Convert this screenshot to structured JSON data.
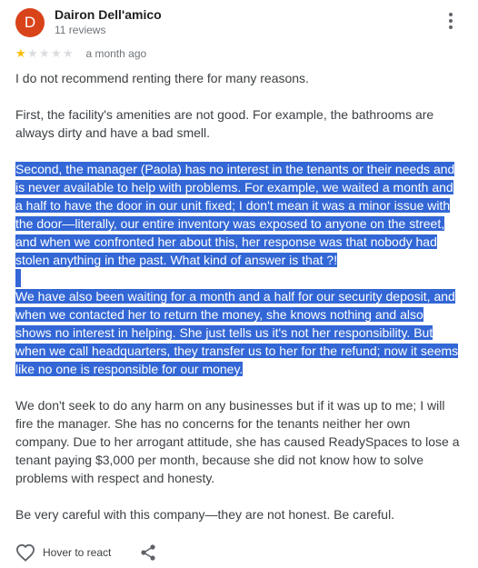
{
  "review": {
    "author": {
      "initial": "D",
      "name": "Dairon Dell'amico",
      "review_count": "11 reviews",
      "avatar_color": "#d9431a"
    },
    "rating": {
      "value": 1,
      "max": 5,
      "filled_star_color": "#fbbc04",
      "empty_star_color": "#dadce0"
    },
    "time_ago": "a month ago",
    "more_icon": "more-vert-icon",
    "paragraphs": {
      "p1": "I do not recommend renting there for many reasons.",
      "p2": "First, the facility's amenities are not good. For example, the bathrooms are always dirty and have a bad smell.",
      "p3": "Second, the manager (Paola) has no interest in the tenants or their needs and is never available to help with problems. For example, we waited a month and a half to have the door in our unit fixed; I don't mean it was a minor issue with the door—literally, our entire inventory was exposed to anyone on the street, and when we confronted her about this, her response was that nobody had stolen anything in the past. What kind of answer is that ?!",
      "p4": "We have also been waiting for a month and a half for our security deposit, and when we contacted her to return the money, she knows nothing and also shows no interest in helping. She just tells us it's not her responsibility. But when we call headquarters, they transfer us to her for the refund; now it seems like no one is responsible for our money.",
      "p5": "We don't seek to do any harm on any businesses but if it was up to me; I will fire the manager. She has no concerns for the tenants neither her own company. Due to her arrogant attitude, she has caused ReadySpaces to lose a tenant paying $3,000 per month, because she did not know how to solve problems with respect and honesty.",
      "p6": "Be very careful with this company—they are not honest. Be careful."
    },
    "selection_color": "#3367d6",
    "actions": {
      "react_label": "Hover to react",
      "react_icon": "heart-outline-icon",
      "share_icon": "share-icon"
    }
  }
}
